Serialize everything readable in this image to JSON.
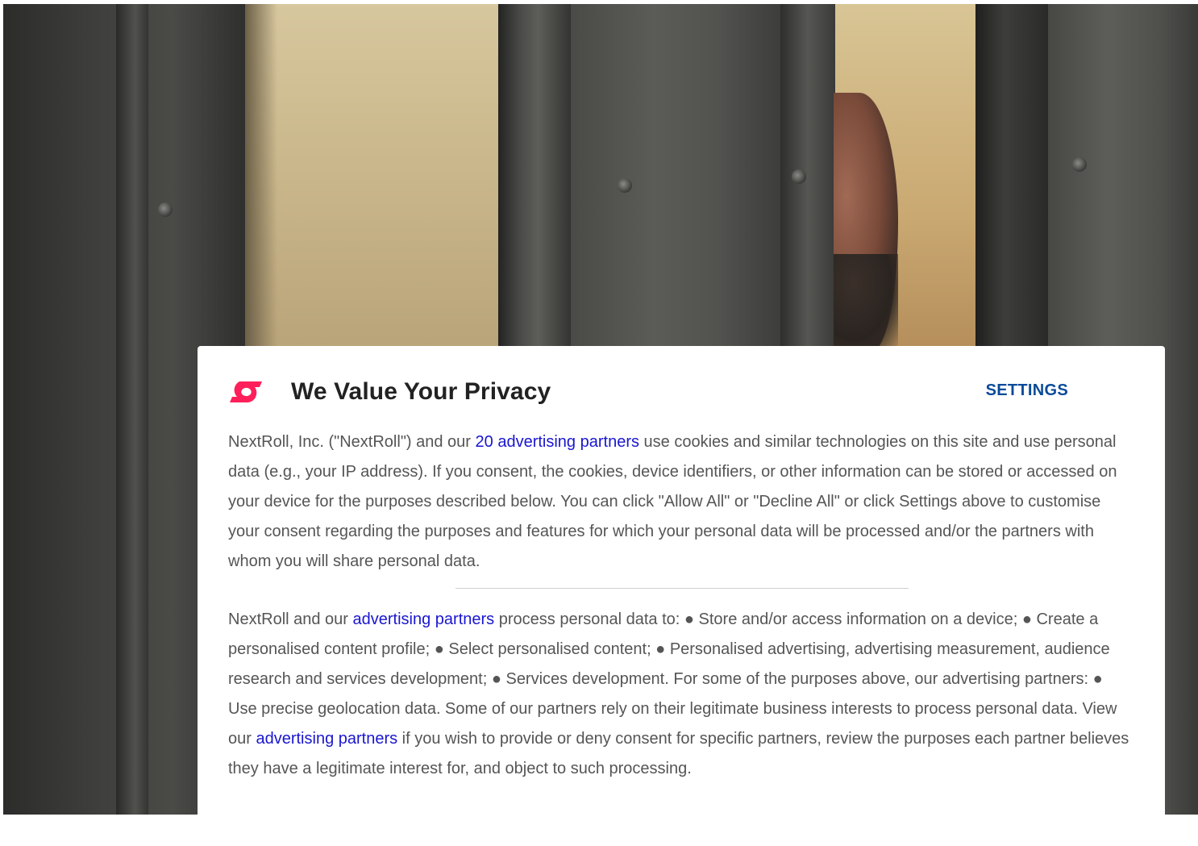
{
  "modal": {
    "title": "We Value Your Privacy",
    "settings_label": "SETTINGS",
    "logo_icon": "nextroll-logo-icon",
    "accent_color": "#ff1f5a",
    "link_color": "#1a16d0",
    "settings_color": "#0a4a9a",
    "paragraph1": {
      "before_link": "NextRoll, Inc. (\"NextRoll\") and our ",
      "link": "20 advertising partners",
      "after_link": " use cookies and similar technologies on this site and use personal data (e.g., your IP address). If you consent, the cookies, device identifiers, or other information can be stored or accessed on your device for the purposes described below. You can click \"Allow All\" or \"Decline All\" or click Settings above to customise your consent regarding the purposes and features for which your personal data will be processed and/or the partners with whom you will share personal data."
    },
    "paragraph2": {
      "before_link1": "NextRoll and our ",
      "link1": "advertising partners",
      "middle": " process personal data to: ● Store and/or access information on a device; ● Create a personalised content profile; ● Select personalised content; ● Personalised advertising, advertising measurement, audience research and services development; ● Services development. For some of the purposes above, our advertising partners: ● Use precise geolocation data. Some of our partners rely on their legitimate business interests to process personal data. View our ",
      "link2": "advertising partners",
      "after_link2": " if you wish to provide or deny consent for specific partners, review the purposes each partner believes they have a legitimate interest for, and object to such processing."
    }
  }
}
